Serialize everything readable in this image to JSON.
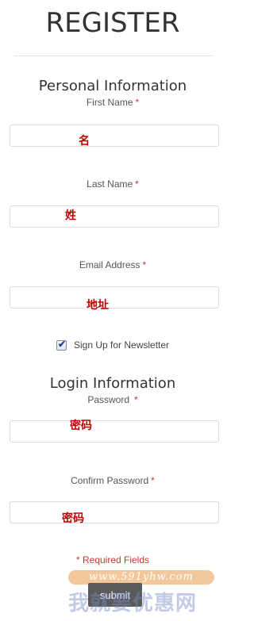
{
  "page_title": "REGISTER",
  "personal": {
    "title": "Personal Information",
    "first_name": {
      "label": "First Name",
      "required_mark": "*",
      "annotation": "名"
    },
    "last_name": {
      "label": "Last Name",
      "required_mark": "*",
      "annotation": "姓"
    },
    "email": {
      "label": "Email Address",
      "required_mark": "*",
      "annotation": "地址"
    },
    "newsletter": {
      "label": "Sign Up for Newsletter",
      "checked": true
    }
  },
  "login": {
    "title": "Login Information",
    "password": {
      "label": "Password",
      "required_mark": "*",
      "annotation": "密码"
    },
    "confirm_password": {
      "label": "Confirm Password",
      "required_mark": "*",
      "annotation": "密码"
    }
  },
  "required_note": "* Required Fields",
  "submit_label": "submit",
  "watermark": {
    "url": "www.591yhw.com",
    "text": "我就要优惠网"
  },
  "colors": {
    "required": "#c0392b",
    "annotation": "#c00000",
    "button": "#5a5a5a"
  }
}
